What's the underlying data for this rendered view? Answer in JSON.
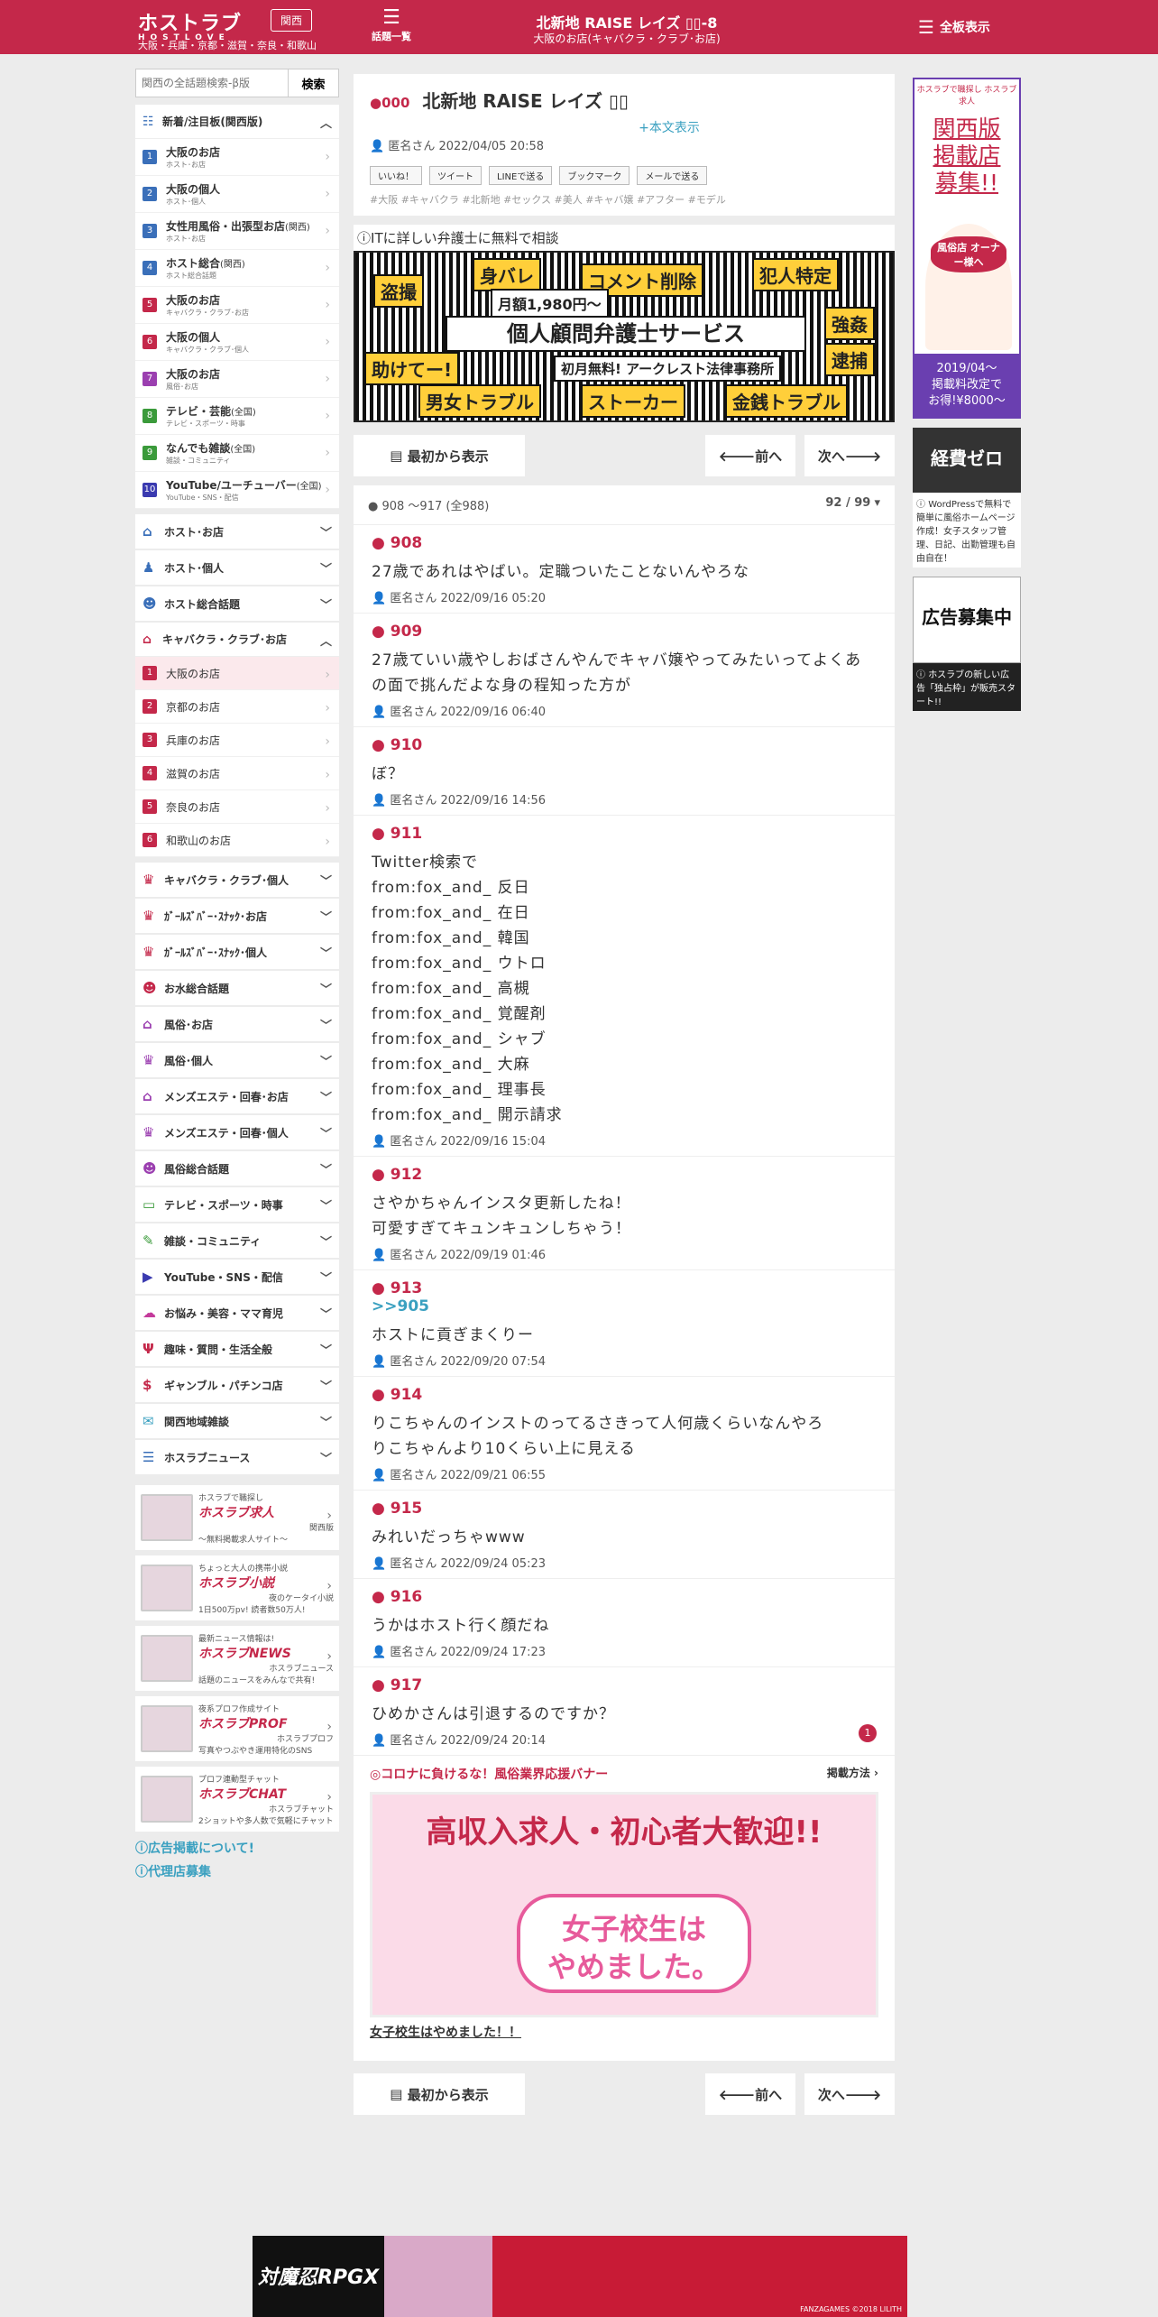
{
  "header": {
    "logo": "ホストラブ",
    "logo_sub": "HOSTLOVE",
    "region": "関西",
    "areas": "大阪・兵庫・京都・滋賀・奈良・和歌山",
    "topics_label": "話題一覧",
    "title": "北新地 RAISE レイズ ▯▯-8",
    "subtitle": "大阪のお店(キャバクラ・クラブ･お店)",
    "menu_label": "全板表示"
  },
  "search": {
    "placeholder": "関西の全話題検索-β版",
    "button": "検索"
  },
  "sidebar": {
    "new_heading": "新着/注目板(関西版)",
    "new_items": [
      {
        "label": "大阪のお店",
        "region": "",
        "sub": "ホスト･お店",
        "color": "#3a6fb9"
      },
      {
        "label": "大阪の個人",
        "region": "",
        "sub": "ホスト･個人",
        "color": "#3a6fb9"
      },
      {
        "label": "女性用風俗・出張型お店",
        "region": "(関西)",
        "sub": "ホスト･お店",
        "color": "#3a6fb9"
      },
      {
        "label": "ホスト総合",
        "region": "(関西)",
        "sub": "ホスト総合話題",
        "color": "#3a6fb9"
      },
      {
        "label": "大阪のお店",
        "region": "",
        "sub": "キャバクラ・クラブ･お店",
        "color": "#c4284a"
      },
      {
        "label": "大阪の個人",
        "region": "",
        "sub": "キャバクラ・クラブ･個人",
        "color": "#c4284a"
      },
      {
        "label": "大阪のお店",
        "region": "",
        "sub": "風俗･お店",
        "color": "#9b3fb0"
      },
      {
        "label": "テレビ・芸能",
        "region": "(全国)",
        "sub": "テレビ・スポーツ・時事",
        "color": "#3a9a3a"
      },
      {
        "label": "なんでも雑談",
        "region": "(全国)",
        "sub": "雑談・コミュニティ",
        "color": "#3a9a3a"
      },
      {
        "label": "YouTube/ユーチューバー",
        "region": "(全国)",
        "sub": "YouTube・SNS・配信",
        "color": "#3a3ab0"
      }
    ],
    "categories_a": [
      {
        "label": "ホスト･お店",
        "icon": "⌂",
        "color": "#3a6fb9"
      },
      {
        "label": "ホスト･個人",
        "icon": "♟",
        "color": "#3a6fb9"
      },
      {
        "label": "ホスト総合話題",
        "icon": "☻",
        "color": "#3a6fb9"
      }
    ],
    "open_category": {
      "label": "キャバクラ・クラブ･お店",
      "icon": "⌂",
      "color": "#c4284a"
    },
    "open_items": [
      "大阪のお店",
      "京都のお店",
      "兵庫のお店",
      "滋賀のお店",
      "奈良のお店",
      "和歌山のお店"
    ],
    "categories_b": [
      {
        "label": "キャバクラ・クラブ･個人",
        "icon": "♛",
        "color": "#c4284a"
      },
      {
        "label": "ｶﾞｰﾙｽﾞﾊﾞｰ･ｽﾅｯｸ･お店",
        "icon": "♛",
        "color": "#c4284a"
      },
      {
        "label": "ｶﾞｰﾙｽﾞﾊﾞｰ･ｽﾅｯｸ･個人",
        "icon": "♛",
        "color": "#c4284a"
      },
      {
        "label": "お水総合話題",
        "icon": "☻",
        "color": "#c4284a"
      },
      {
        "label": "風俗･お店",
        "icon": "⌂",
        "color": "#9b3fb0"
      },
      {
        "label": "風俗･個人",
        "icon": "♛",
        "color": "#9b3fb0"
      },
      {
        "label": "メンズエステ・回春･お店",
        "icon": "⌂",
        "color": "#9b3fb0"
      },
      {
        "label": "メンズエステ・回春･個人",
        "icon": "♛",
        "color": "#9b3fb0"
      },
      {
        "label": "風俗総合話題",
        "icon": "☻",
        "color": "#9b3fb0"
      },
      {
        "label": "テレビ・スポーツ・時事",
        "icon": "▭",
        "color": "#3a9a3a"
      },
      {
        "label": "雑談・コミュニティ",
        "icon": "✎",
        "color": "#3a9a3a"
      },
      {
        "label": "YouTube・SNS・配信",
        "icon": "▶",
        "color": "#3a3ab0"
      },
      {
        "label": "お悩み・美容・ママ育児",
        "icon": "☁",
        "color": "#c43a9b"
      },
      {
        "label": "趣味・質問・生活全般",
        "icon": "Ψ",
        "color": "#c4284a"
      },
      {
        "label": "ギャンブル・パチンコ店",
        "icon": "$",
        "color": "#c4284a"
      },
      {
        "label": "関西地域雑談",
        "icon": "✉",
        "color": "#3aa0c0"
      },
      {
        "label": "ホスラブニュース",
        "icon": "☰",
        "color": "#3a6fb9"
      }
    ],
    "promos": [
      {
        "title": "ホスラブ求人",
        "line1": "ホスラブで職探し",
        "line2": "関西版",
        "line3": "〜無料掲載求人サイト〜"
      },
      {
        "title": "ホスラブ小説",
        "line1": "ちょっと大人の携帯小説",
        "line2": "夜のケータイ小説",
        "line3": "1日500万pv! 読者数50万人!"
      },
      {
        "title": "ホスラブNEWS",
        "line1": "最新ニュース情報は!",
        "line2": "ホスラブニュース",
        "line3": "話題のニュースをみんなで共有!"
      },
      {
        "title": "ホスラブPROF",
        "line1": "夜系プロフ作成サイト",
        "line2": "ホスラブプロフ",
        "line3": "写真やつぶやき運用特化のSNS"
      },
      {
        "title": "ホスラブCHAT",
        "line1": "プロフ連動型チャット",
        "line2": "ホスラブチャット",
        "line3": "2ショットや多人数で気軽にチャット"
      }
    ],
    "footer_links": [
      "広告掲載について!",
      "代理店募集"
    ]
  },
  "thread": {
    "num": "000",
    "title": "北新地 RAISE レイズ ▯▯",
    "show_body": "+本文表示",
    "author": "匿名さん 2022/04/05 20:58",
    "shares": [
      "いいね！",
      "ツイート",
      "LINEで送る",
      "ブックマーク",
      "メールで送る"
    ],
    "tags": "#大阪 #キャバクラ #北新地 #セックス #美人 #キャバ嬢 #アフター #モデル"
  },
  "ad1": {
    "heading": "ITに詳しい弁護士に無料で相談",
    "words": [
      "盗撮",
      "身バレ",
      "コメント削除",
      "犯人特定",
      "強姦",
      "助けてー!",
      "逮捕",
      "男女トラブル",
      "ストーカー",
      "金銭トラブル"
    ],
    "main": "個人顧問弁護士サービス",
    "price": "月額1,980円〜",
    "sub": "初月無料! アークレスト法律事務所"
  },
  "nav": {
    "from_start": "最初から表示",
    "prev": "前へ",
    "next": "次へ"
  },
  "comments_header": {
    "range": "908 ～917 (全988)",
    "page": "92 / 99"
  },
  "comments": [
    {
      "n": "908",
      "quote": "",
      "body": "27歳であれはやばい。定職ついたことないんやろな",
      "author": "匿名さん 2022/09/16 05:20"
    },
    {
      "n": "909",
      "quote": "",
      "body": "27歳ていい歳やしおばさんやんでキャバ嬢やってみたいってよくあの面で挑んだよな身の程知った方が",
      "author": "匿名さん 2022/09/16 06:40"
    },
    {
      "n": "910",
      "quote": "",
      "body": "ぼ？",
      "author": "匿名さん 2022/09/16 14:56"
    },
    {
      "n": "911",
      "quote": "",
      "body": "Twitter検索で\nfrom:fox_and_ 反日\nfrom:fox_and_ 在日\nfrom:fox_and_ 韓国\nfrom:fox_and_ ウトロ\nfrom:fox_and_ 高槻\nfrom:fox_and_ 覚醒剤\nfrom:fox_and_ シャブ\nfrom:fox_and_ 大麻\nfrom:fox_and_ 理事長\nfrom:fox_and_ 開示請求",
      "author": "匿名さん 2022/09/16 15:04"
    },
    {
      "n": "912",
      "quote": "",
      "body": "さやかちゃんインスタ更新したね！\n可愛すぎてキュンキュンしちゃう！",
      "author": "匿名さん 2022/09/19 01:46"
    },
    {
      "n": "913",
      "quote": ">>905",
      "body": "ホストに貢ぎまくりー",
      "author": "匿名さん 2022/09/20 07:54"
    },
    {
      "n": "914",
      "quote": "",
      "body": "りこちゃんのインストのってるさきって人何歳くらいなんやろ\nりこちゃんより10くらい上に見える",
      "author": "匿名さん 2022/09/21 06:55"
    },
    {
      "n": "915",
      "quote": "",
      "body": "みれいだっちゃwww",
      "author": "匿名さん 2022/09/24 05:23"
    },
    {
      "n": "916",
      "quote": "",
      "body": "うかはホスト行く顔だね",
      "author": "匿名さん 2022/09/24 17:23"
    },
    {
      "n": "917",
      "quote": "",
      "body": "ひめかさんは引退するのですか？",
      "author": "匿名さん 2022/09/24 20:14"
    }
  ],
  "reply_badge": "1",
  "corona": {
    "text": "◎コロナに負けるな！風俗業界応援バナー",
    "method": "掲載方法"
  },
  "big_banner": {
    "line1": "高収入求人・初心者大歓迎!!",
    "line2": "女子校生は\nやめました。",
    "link": "女子校生はやめました！！"
  },
  "right": {
    "ad1_top": "ホスラブで職探し ホスラブ求人",
    "ad1_main": "関西版\n掲載店\n募集!!",
    "ad1_badge": "風俗店 オーナー様へ",
    "ad1_price": "2019/04〜\n掲載料改定で\nお得!¥8000〜",
    "ad2_main": "経費ゼロ",
    "ad2_text": "WordPressで無料で簡単に風俗ホームページ作成！女子スタッフ管理、日記、出勤管理も自由自在！",
    "ad3_main": "広告募集中",
    "ad3_text": "ホスラブの新しい広告「独占枠」が販売スタート!!"
  },
  "bottom_ad": {
    "logo": "対魔忍RPGX",
    "credit": "FANZAGAMES ©2018 LILITH"
  }
}
